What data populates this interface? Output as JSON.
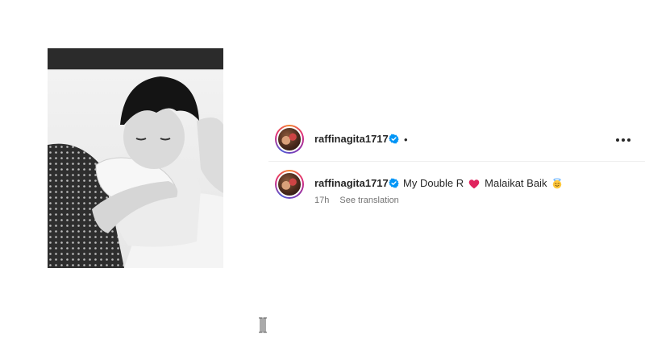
{
  "post": {
    "photo_alt": "",
    "username": "raffinagita1717",
    "more_icon": "more-horizontal-icon",
    "separator": "•"
  },
  "caption": {
    "username": "raffinagita1717",
    "text_before": "My Double R",
    "text_after": "Malaikat Baik",
    "heart_icon": "red-heart-emoji",
    "halo_icon": "smiling-face-with-halo-emoji",
    "time": "17h",
    "translate_link": "See translation"
  },
  "colors": {
    "verified": "#0095f6",
    "heart": "#e0245e",
    "meta": "#737373",
    "text": "#262626"
  }
}
